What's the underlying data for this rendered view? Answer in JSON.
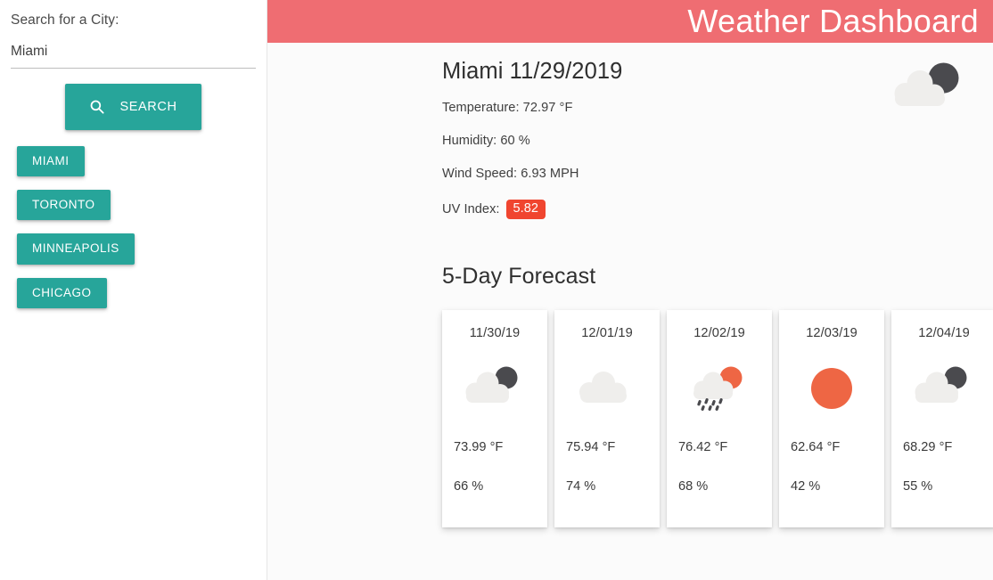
{
  "header": {
    "title": "Weather Dashboard",
    "bar_color": "#ef6d72"
  },
  "sidebar": {
    "search_label": "Search for a City:",
    "search_input_value": "Miami",
    "search_input_placeholder": "",
    "search_button_label": "SEARCH",
    "search_icon": "search-icon",
    "accent_color": "#27a59a",
    "history": [
      {
        "label": "MIAMI"
      },
      {
        "label": "TORONTO"
      },
      {
        "label": "MINNEAPOLIS"
      },
      {
        "label": "CHICAGO"
      }
    ]
  },
  "current": {
    "title": "Miami 11/29/2019",
    "city": "Miami",
    "date": "11/29/2019",
    "temperature": "Temperature: 72.97 °F",
    "humidity": "Humidity: 60 %",
    "wind": "Wind Speed: 6.93 MPH",
    "uv_label": "UV Index:",
    "uv_value": "5.82",
    "uv_badge_color": "#f0452f",
    "icon": "broken-clouds-icon"
  },
  "forecast": {
    "title": "5-Day Forecast",
    "days": [
      {
        "date": "11/30/19",
        "temp": "73.99 °F",
        "humidity": "66 %",
        "icon": "broken-clouds-icon"
      },
      {
        "date": "12/01/19",
        "temp": "75.94 °F",
        "humidity": "74 %",
        "icon": "overcast-clouds-icon"
      },
      {
        "date": "12/02/19",
        "temp": "76.42 °F",
        "humidity": "68 %",
        "icon": "shower-rain-sun-icon"
      },
      {
        "date": "12/03/19",
        "temp": "62.64 °F",
        "humidity": "42 %",
        "icon": "clear-sky-sun-icon"
      },
      {
        "date": "12/04/19",
        "temp": "68.29 °F",
        "humidity": "55 %",
        "icon": "broken-clouds-icon"
      }
    ]
  },
  "palette": {
    "cloud_light": "#efeeec",
    "cloud_dark": "#4a4a4e",
    "sun_orange": "#ee6644"
  }
}
